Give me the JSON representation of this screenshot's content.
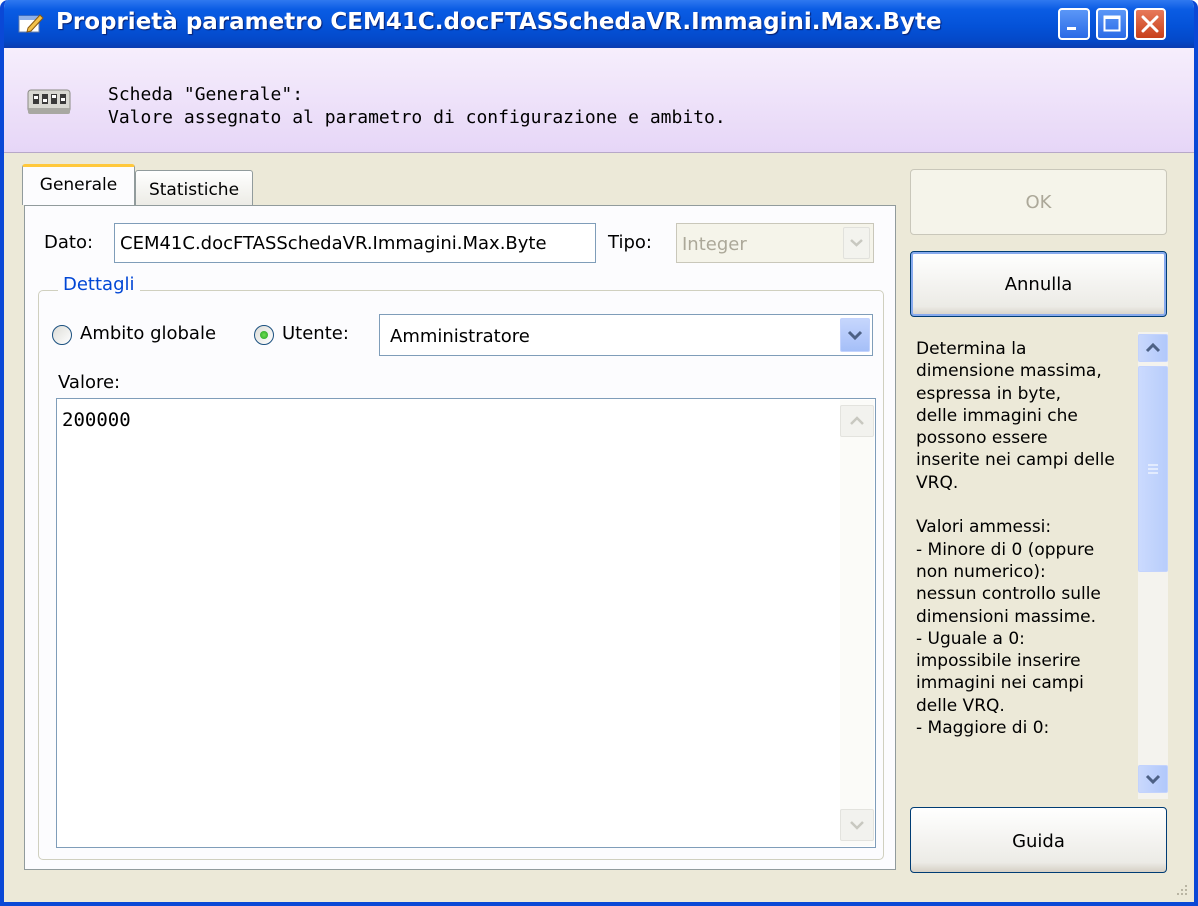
{
  "window": {
    "title": "Proprietà parametro CEM41C.docFTASSchedaVR.Immagini.Max.Byte",
    "controls": [
      "minimize",
      "maximize",
      "close"
    ]
  },
  "header": {
    "line1": "Scheda \"Generale\":",
    "line2": "Valore assegnato al parametro di configurazione e ambito."
  },
  "tabs": [
    {
      "label": "Generale",
      "active": true
    },
    {
      "label": "Statistiche",
      "active": false
    }
  ],
  "form": {
    "dato_label": "Dato:",
    "dato_value": "CEM41C.docFTASSchedaVR.Immagini.Max.Byte",
    "tipo_label": "Tipo:",
    "tipo_value": "Integer",
    "group_title": "Dettagli",
    "radio_global": "Ambito globale",
    "radio_user": "Utente:",
    "selected_scope": "Utente",
    "user_value": "Amministratore",
    "valore_label": "Valore:",
    "valore_value": "200000"
  },
  "buttons": {
    "ok": "OK",
    "cancel": "Annulla",
    "help": "Guida"
  },
  "help_text": "Determina la\ndimensione massima,\nespressa in byte,\ndelle immagini che\npossono essere\ninserite nei campi delle\nVRQ.\n\nValori ammessi:\n- Minore di 0 (oppure\nnon numerico):\nnessun controllo sulle\ndimensioni massime.\n- Uguale a 0:\nimpossibile inserire\nimmagini nei campi\ndelle VRQ.\n- Maggiore di 0:",
  "colors": {
    "titlebar": "#0452d8",
    "header_bg": "#ece0f9",
    "group_title": "#0046d5",
    "dialog_bg": "#ece9d8"
  }
}
